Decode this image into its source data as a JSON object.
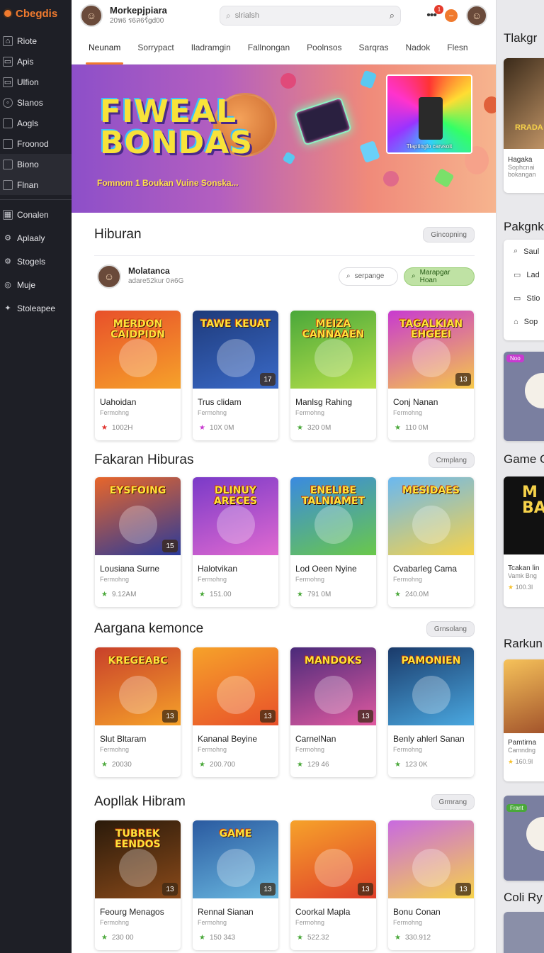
{
  "app": {
    "brand": "Cbegdis"
  },
  "sidebar": {
    "items": [
      {
        "label": "Riote",
        "icon": "door-icon"
      },
      {
        "label": "Apis",
        "icon": "document-icon"
      },
      {
        "label": "Ulfion",
        "icon": "document-icon"
      },
      {
        "label": "Slanos",
        "icon": "circle-icon"
      },
      {
        "label": "Aogls",
        "icon": "square-icon"
      },
      {
        "label": "Froonod",
        "icon": "square-icon"
      },
      {
        "label": "Biono",
        "icon": "square-icon"
      },
      {
        "label": "Flnan",
        "icon": "square-icon"
      }
    ],
    "items2": [
      {
        "label": "Conalen",
        "icon": "grid-icon"
      },
      {
        "label": "Aplaaly",
        "icon": "gear-icon"
      },
      {
        "label": "Stogels",
        "icon": "settings-icon"
      },
      {
        "label": "Muje",
        "icon": "globe-icon"
      },
      {
        "label": "Stoleapee",
        "icon": "bird-icon"
      }
    ]
  },
  "header": {
    "user_name": "Morkepjpiara",
    "user_sub": "20ห6 ร6ส6ร์gd00",
    "search_placeholder": "slrialsh",
    "notification_count": "1"
  },
  "tabs": [
    "Neunam",
    "Sorrypact",
    "Iladramgin",
    "Fallnongan",
    "Poolnsos",
    "Sarqras",
    "Nadok",
    "Flesn"
  ],
  "hero": {
    "title_line1": "FIWEAL",
    "title_line2": "BONDAS",
    "subtitle": "Fomnom 1 Boukan Vuine Sonska...",
    "card_caption": "Tlaptinglo carvsoit"
  },
  "section_main": {
    "title": "Hiburan",
    "pill": "Gincopning",
    "creator_name": "Molatanca",
    "creator_sub": "adare52kur 0ล6G",
    "creator_search": "serpange",
    "creator_button": "Marapgar Hoan"
  },
  "sections": [
    {
      "title": "",
      "games": [
        {
          "thumb_title": "MERDON CAIDPIDN",
          "name": "Uahoidan",
          "category": "Fermohng",
          "stat": "1002H",
          "badge": "",
          "colors": [
            "#e8502a",
            "#f6a22a"
          ]
        },
        {
          "thumb_title": "TAWE KEUAT",
          "name": "Trus clidam",
          "category": "Fermohng",
          "stat": "10X 0M",
          "badge": "17",
          "colors": [
            "#1e3a7a",
            "#3a6ac8"
          ]
        },
        {
          "thumb_title": "MEIZA CANNAAEN",
          "name": "Manlsg Rahing",
          "category": "Fermohng",
          "stat": "320 0M",
          "badge": "",
          "colors": [
            "#4aa83a",
            "#b8e04a"
          ]
        },
        {
          "thumb_title": "TAGALKIAN EHGEEI",
          "name": "Conj Nanan",
          "category": "Fermohng",
          "stat": "110 0M",
          "badge": "13",
          "colors": [
            "#c83ad0",
            "#f6c84a"
          ]
        }
      ]
    },
    {
      "title": "Fakaran Hiburas",
      "pill": "Crmplang",
      "games": [
        {
          "thumb_title": "EYSFOING",
          "name": "Lousiana Surne",
          "category": "Fermohng",
          "stat": "9.12AM",
          "badge": "15",
          "colors": [
            "#e8662a",
            "#2a3a9a"
          ]
        },
        {
          "thumb_title": "DLINUY ARECES",
          "name": "Halotvikan",
          "category": "Fermohng",
          "stat": "151.00",
          "badge": "",
          "colors": [
            "#7a3ac8",
            "#e06ad0"
          ]
        },
        {
          "thumb_title": "ENELIBE TALNIAMET",
          "name": "Lod Oeen Nyine",
          "category": "Fermohng",
          "stat": "791 0M",
          "badge": "",
          "colors": [
            "#3a8ae0",
            "#6ac84a"
          ]
        },
        {
          "thumb_title": "MESIDAES",
          "name": "Cvabarleg Cama",
          "category": "Fermohng",
          "stat": "240.0M",
          "badge": "",
          "colors": [
            "#6ab8f0",
            "#f6d24a"
          ]
        }
      ]
    },
    {
      "title": "Aargana kemonce",
      "pill": "Grnsolang",
      "games": [
        {
          "thumb_title": "KREGEABC",
          "name": "Slut Bltaram",
          "category": "Fermohng",
          "stat": "20030",
          "badge": "13",
          "colors": [
            "#c8402a",
            "#f6a22a"
          ]
        },
        {
          "thumb_title": "",
          "name": "Kananal Beyine",
          "category": "Fermohng",
          "stat": "200.700",
          "badge": "13",
          "colors": [
            "#f6a22a",
            "#e8502a"
          ]
        },
        {
          "thumb_title": "MANDOKS",
          "name": "CarnelNan",
          "category": "Fermohng",
          "stat": "129 46",
          "badge": "13",
          "colors": [
            "#4a2a7a",
            "#e05aa0"
          ]
        },
        {
          "thumb_title": "PAMONIEN",
          "name": "Benly ahlerl Sanan",
          "category": "Fermohng",
          "stat": "123 0K",
          "badge": "",
          "colors": [
            "#1a3a6a",
            "#4aa8e0"
          ]
        }
      ]
    },
    {
      "title": "Aopllak Hibram",
      "pill": "Grmrang",
      "games": [
        {
          "thumb_title": "TUBREK EENDOS",
          "name": "Feourg Menagos",
          "category": "Fermohng",
          "stat": "230 00",
          "badge": "13",
          "colors": [
            "#2a1a0a",
            "#8a4a1a"
          ]
        },
        {
          "thumb_title": "GAME",
          "name": "Rennal Sianan",
          "category": "Fermohng",
          "stat": "150 343",
          "badge": "13",
          "colors": [
            "#2a5aa0",
            "#6ab8e0"
          ]
        },
        {
          "thumb_title": "",
          "name": "Coorkal Mapla",
          "category": "Fermohng",
          "stat": "522.32",
          "badge": "13",
          "colors": [
            "#f6a22a",
            "#e0402a"
          ]
        },
        {
          "thumb_title": "",
          "name": "Bonu Conan",
          "category": "Fermohng",
          "stat": "330.912",
          "badge": "13",
          "colors": [
            "#c86ae0",
            "#f6d24a"
          ]
        }
      ]
    }
  ],
  "right_panel": {
    "title1": "Tlakgr",
    "card1_text": "Hagaka",
    "card1_sub": "Sophcnai",
    "card1_sub2": "bokangan",
    "card1_label": "RRADA",
    "title2": "Pakgnk",
    "list": [
      {
        "label": "Saul",
        "icon": "search-icon"
      },
      {
        "label": "Lad",
        "icon": "square-icon"
      },
      {
        "label": "Stio",
        "icon": "square-icon"
      },
      {
        "label": "Sop",
        "icon": "home-icon"
      }
    ],
    "card2_badge": "Noo",
    "title3": "Game C",
    "card3_label": "M BA",
    "card3_text": "Tcakan lin",
    "card3_sub": "Vamk Bng",
    "card3_stat": "100.3l",
    "title4": "Rarkun",
    "card4_text": "Pamtirna",
    "card4_sub": "Camndng",
    "card4_stat": "160.9l",
    "card5_badge": "Frant",
    "title5": "Coli Ry"
  }
}
